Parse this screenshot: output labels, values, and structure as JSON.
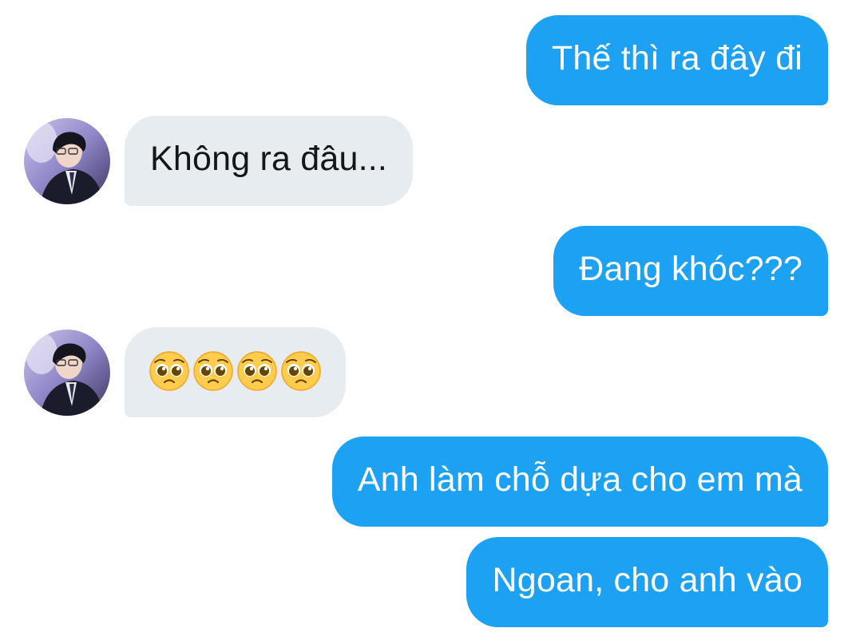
{
  "conversation": {
    "messages": [
      {
        "direction": "sent",
        "text": "Thế thì ra đây đi"
      },
      {
        "direction": "received",
        "text": "Không ra đâu..."
      },
      {
        "direction": "sent",
        "text": "Đang khóc???"
      },
      {
        "direction": "received",
        "emoji": [
          "pleading-face",
          "pleading-face",
          "pleading-face",
          "pleading-face"
        ]
      },
      {
        "direction": "sent",
        "text": "Anh làm chỗ dựa cho em mà"
      },
      {
        "direction": "sent",
        "text": "Ngoan, cho anh vào"
      }
    ]
  },
  "colors": {
    "sent_bubble": "#1da1f2",
    "received_bubble": "#e6ecf0",
    "sent_text": "#ffffff",
    "received_text": "#14171a"
  }
}
